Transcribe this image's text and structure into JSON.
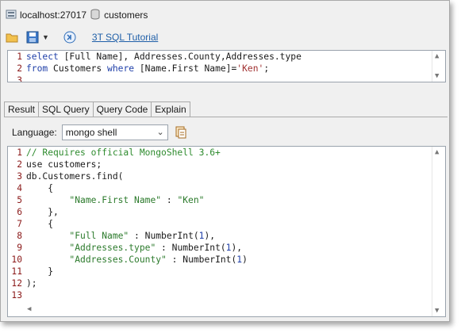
{
  "titlebar": {
    "server": "localhost:27017",
    "db": "customers"
  },
  "toolbar": {
    "link": "3T SQL Tutorial"
  },
  "sql": {
    "lines": [
      {
        "n": "1",
        "text": "select [Full Name], Addresses.County,Addresses.type"
      },
      {
        "n": "2",
        "text": "from Customers where [Name.First Name]='Ken';"
      },
      {
        "n": "3",
        "text": ""
      }
    ]
  },
  "tabs": [
    "Result",
    "SQL Query",
    "Query Code",
    "Explain"
  ],
  "language": {
    "label": "Language:",
    "selected": "mongo shell"
  },
  "code": {
    "lines": [
      {
        "n": "1",
        "text": "// Requires official MongoShell 3.6+"
      },
      {
        "n": "2",
        "text": "use customers;"
      },
      {
        "n": "3",
        "text": "db.Customers.find("
      },
      {
        "n": "4",
        "text": "    {"
      },
      {
        "n": "5",
        "text": "        \"Name.First Name\" : \"Ken\""
      },
      {
        "n": "6",
        "text": "    },"
      },
      {
        "n": "7",
        "text": "    {"
      },
      {
        "n": "8",
        "text": "        \"Full Name\" : NumberInt(1),"
      },
      {
        "n": "9",
        "text": "        \"Addresses.type\" : NumberInt(1),"
      },
      {
        "n": "10",
        "text": "        \"Addresses.County\" : NumberInt(1)"
      },
      {
        "n": "11",
        "text": "    }"
      },
      {
        "n": "12",
        "text": ");"
      },
      {
        "n": "13",
        "text": ""
      }
    ]
  },
  "colors": {
    "comment": "#2e8b2e",
    "keyword": "#1f3fa8",
    "string": "#a03030",
    "lineNumber": "#8b1a1a",
    "link": "#1f5fa8"
  }
}
